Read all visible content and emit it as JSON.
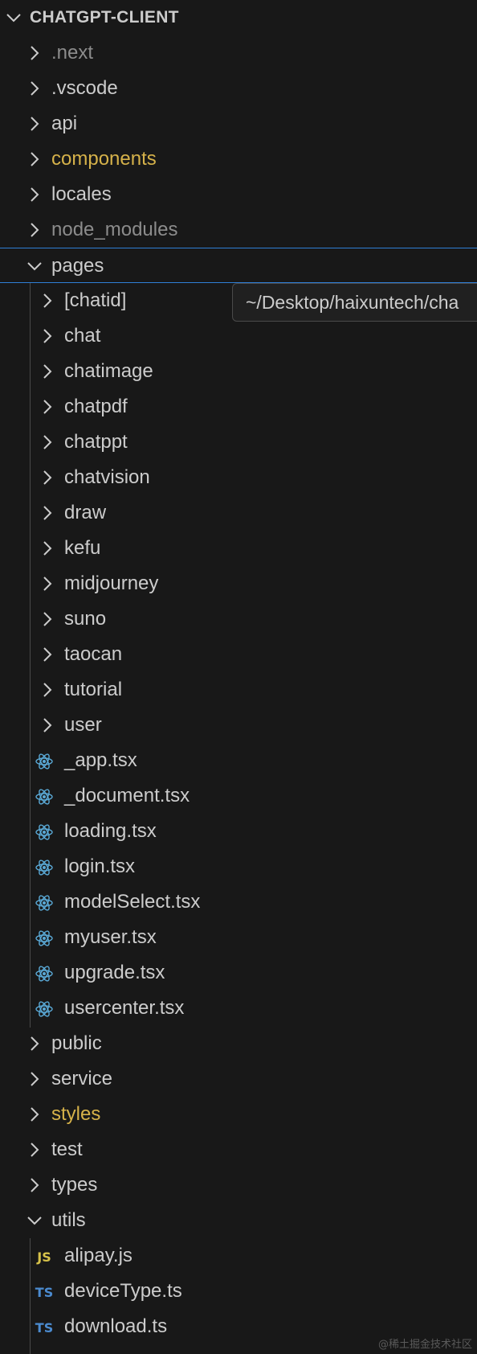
{
  "explorer": {
    "root_title": "CHATGPT-CLIENT",
    "items": [
      {
        "label": ".next",
        "kind": "folder",
        "expanded": false,
        "level": 1,
        "style": "dim"
      },
      {
        "label": ".vscode",
        "kind": "folder",
        "expanded": false,
        "level": 1,
        "style": "normal"
      },
      {
        "label": "api",
        "kind": "folder",
        "expanded": false,
        "level": 1,
        "style": "normal"
      },
      {
        "label": "components",
        "kind": "folder",
        "expanded": false,
        "level": 1,
        "style": "modified"
      },
      {
        "label": "locales",
        "kind": "folder",
        "expanded": false,
        "level": 1,
        "style": "normal"
      },
      {
        "label": "node_modules",
        "kind": "folder",
        "expanded": false,
        "level": 1,
        "style": "dim"
      },
      {
        "label": "pages",
        "kind": "folder",
        "expanded": true,
        "level": 1,
        "style": "normal",
        "selected": true
      },
      {
        "label": "[chatid]",
        "kind": "folder",
        "expanded": false,
        "level": 2,
        "style": "normal"
      },
      {
        "label": "chat",
        "kind": "folder",
        "expanded": false,
        "level": 2,
        "style": "normal"
      },
      {
        "label": "chatimage",
        "kind": "folder",
        "expanded": false,
        "level": 2,
        "style": "normal"
      },
      {
        "label": "chatpdf",
        "kind": "folder",
        "expanded": false,
        "level": 2,
        "style": "normal"
      },
      {
        "label": "chatppt",
        "kind": "folder",
        "expanded": false,
        "level": 2,
        "style": "normal"
      },
      {
        "label": "chatvision",
        "kind": "folder",
        "expanded": false,
        "level": 2,
        "style": "normal"
      },
      {
        "label": "draw",
        "kind": "folder",
        "expanded": false,
        "level": 2,
        "style": "normal"
      },
      {
        "label": "kefu",
        "kind": "folder",
        "expanded": false,
        "level": 2,
        "style": "normal"
      },
      {
        "label": "midjourney",
        "kind": "folder",
        "expanded": false,
        "level": 2,
        "style": "normal"
      },
      {
        "label": "suno",
        "kind": "folder",
        "expanded": false,
        "level": 2,
        "style": "normal"
      },
      {
        "label": "taocan",
        "kind": "folder",
        "expanded": false,
        "level": 2,
        "style": "normal"
      },
      {
        "label": "tutorial",
        "kind": "folder",
        "expanded": false,
        "level": 2,
        "style": "normal"
      },
      {
        "label": "user",
        "kind": "folder",
        "expanded": false,
        "level": 2,
        "style": "normal"
      },
      {
        "label": "_app.tsx",
        "kind": "file",
        "icon": "react-icon",
        "level": 2,
        "style": "normal"
      },
      {
        "label": "_document.tsx",
        "kind": "file",
        "icon": "react-icon",
        "level": 2,
        "style": "normal"
      },
      {
        "label": "loading.tsx",
        "kind": "file",
        "icon": "react-icon",
        "level": 2,
        "style": "normal"
      },
      {
        "label": "login.tsx",
        "kind": "file",
        "icon": "react-icon",
        "level": 2,
        "style": "normal"
      },
      {
        "label": "modelSelect.tsx",
        "kind": "file",
        "icon": "react-icon",
        "level": 2,
        "style": "normal"
      },
      {
        "label": "myuser.tsx",
        "kind": "file",
        "icon": "react-icon",
        "level": 2,
        "style": "normal"
      },
      {
        "label": "upgrade.tsx",
        "kind": "file",
        "icon": "react-icon",
        "level": 2,
        "style": "normal"
      },
      {
        "label": "usercenter.tsx",
        "kind": "file",
        "icon": "react-icon",
        "level": 2,
        "style": "normal"
      },
      {
        "label": "public",
        "kind": "folder",
        "expanded": false,
        "level": 1,
        "style": "normal"
      },
      {
        "label": "service",
        "kind": "folder",
        "expanded": false,
        "level": 1,
        "style": "normal"
      },
      {
        "label": "styles",
        "kind": "folder",
        "expanded": false,
        "level": 1,
        "style": "modified"
      },
      {
        "label": "test",
        "kind": "folder",
        "expanded": false,
        "level": 1,
        "style": "normal"
      },
      {
        "label": "types",
        "kind": "folder",
        "expanded": false,
        "level": 1,
        "style": "normal"
      },
      {
        "label": "utils",
        "kind": "folder",
        "expanded": true,
        "level": 1,
        "style": "normal"
      },
      {
        "label": "alipay.js",
        "kind": "file",
        "icon": "js-icon",
        "badge": "JS",
        "level": 2,
        "style": "normal"
      },
      {
        "label": "deviceType.ts",
        "kind": "file",
        "icon": "ts-icon",
        "badge": "TS",
        "level": 2,
        "style": "normal"
      },
      {
        "label": "download.ts",
        "kind": "file",
        "icon": "ts-icon",
        "badge": "TS",
        "level": 2,
        "style": "normal"
      }
    ]
  },
  "tooltip": {
    "text": "~/Desktop/haixuntech/cha"
  },
  "watermark": "@稀土掘金技术社区",
  "colors": {
    "background": "#181818",
    "text": "#cccccc",
    "dim_text": "#8c8c8c",
    "modified_text": "#d6b24a",
    "selection_border": "#2f7fd6",
    "react_icon": "#5aa9d6",
    "js_badge": "#d7c24a",
    "ts_badge": "#4b8bd0"
  }
}
